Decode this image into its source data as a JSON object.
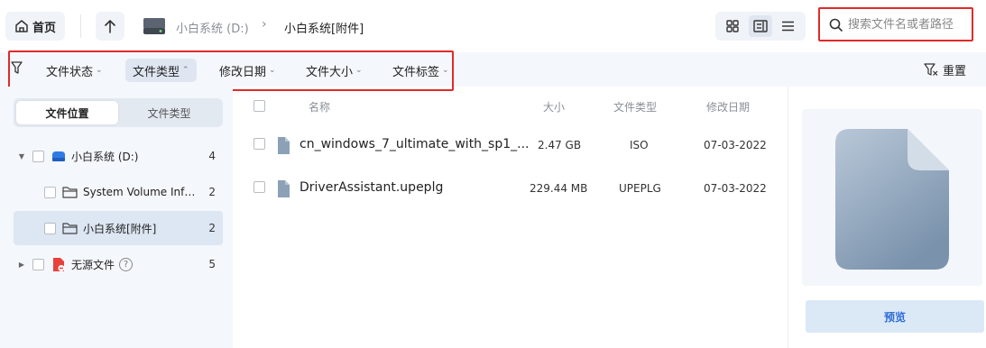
{
  "topbar": {
    "home_label": "首页",
    "drive_crumb": "小白系统 (D:)",
    "crumb_separator": "›",
    "current_folder": "小白系统[附件]",
    "search_placeholder": "搜索文件名或者路径"
  },
  "filters": {
    "items": [
      {
        "label": "文件状态",
        "chevron": "⌄",
        "active": false
      },
      {
        "label": "文件类型",
        "chevron": "⌃",
        "active": true
      },
      {
        "label": "修改日期",
        "chevron": "⌄",
        "active": false
      },
      {
        "label": "文件大小",
        "chevron": "⌄",
        "active": false
      },
      {
        "label": "文件标签",
        "chevron": "⌄",
        "active": false
      }
    ],
    "reset_label": "重置"
  },
  "left_panel": {
    "tabs": [
      "文件位置",
      "文件类型"
    ],
    "active_tab": "文件位置",
    "tree": [
      {
        "label": "小白系统 (D:)",
        "count": "4",
        "icon": "drive-icon",
        "expanded": true
      },
      {
        "label": "System Volume Information",
        "count": "2",
        "icon": "folder-icon"
      },
      {
        "label": "小白系统[附件]",
        "count": "2",
        "icon": "folder-icon",
        "selected": true
      },
      {
        "label": "无源文件",
        "count": "5",
        "icon": "orphan-file-icon",
        "help": "?"
      }
    ]
  },
  "file_list": {
    "headers": {
      "name": "名称",
      "size": "大小",
      "type": "文件类型",
      "date": "修改日期"
    },
    "rows": [
      {
        "name": "cn_windows_7_ultimate_with_sp1_...",
        "size": "2.47 GB",
        "type": "ISO",
        "date": "07-03-2022"
      },
      {
        "name": "DriverAssistant.upeplg",
        "size": "229.44 MB",
        "type": "UPEPLG",
        "date": "07-03-2022"
      }
    ]
  },
  "preview": {
    "button_label": "预览"
  },
  "colors": {
    "accent": "#2c6cd6",
    "highlight_border": "#e02a2a",
    "panel_bg": "#f4f7fb"
  }
}
